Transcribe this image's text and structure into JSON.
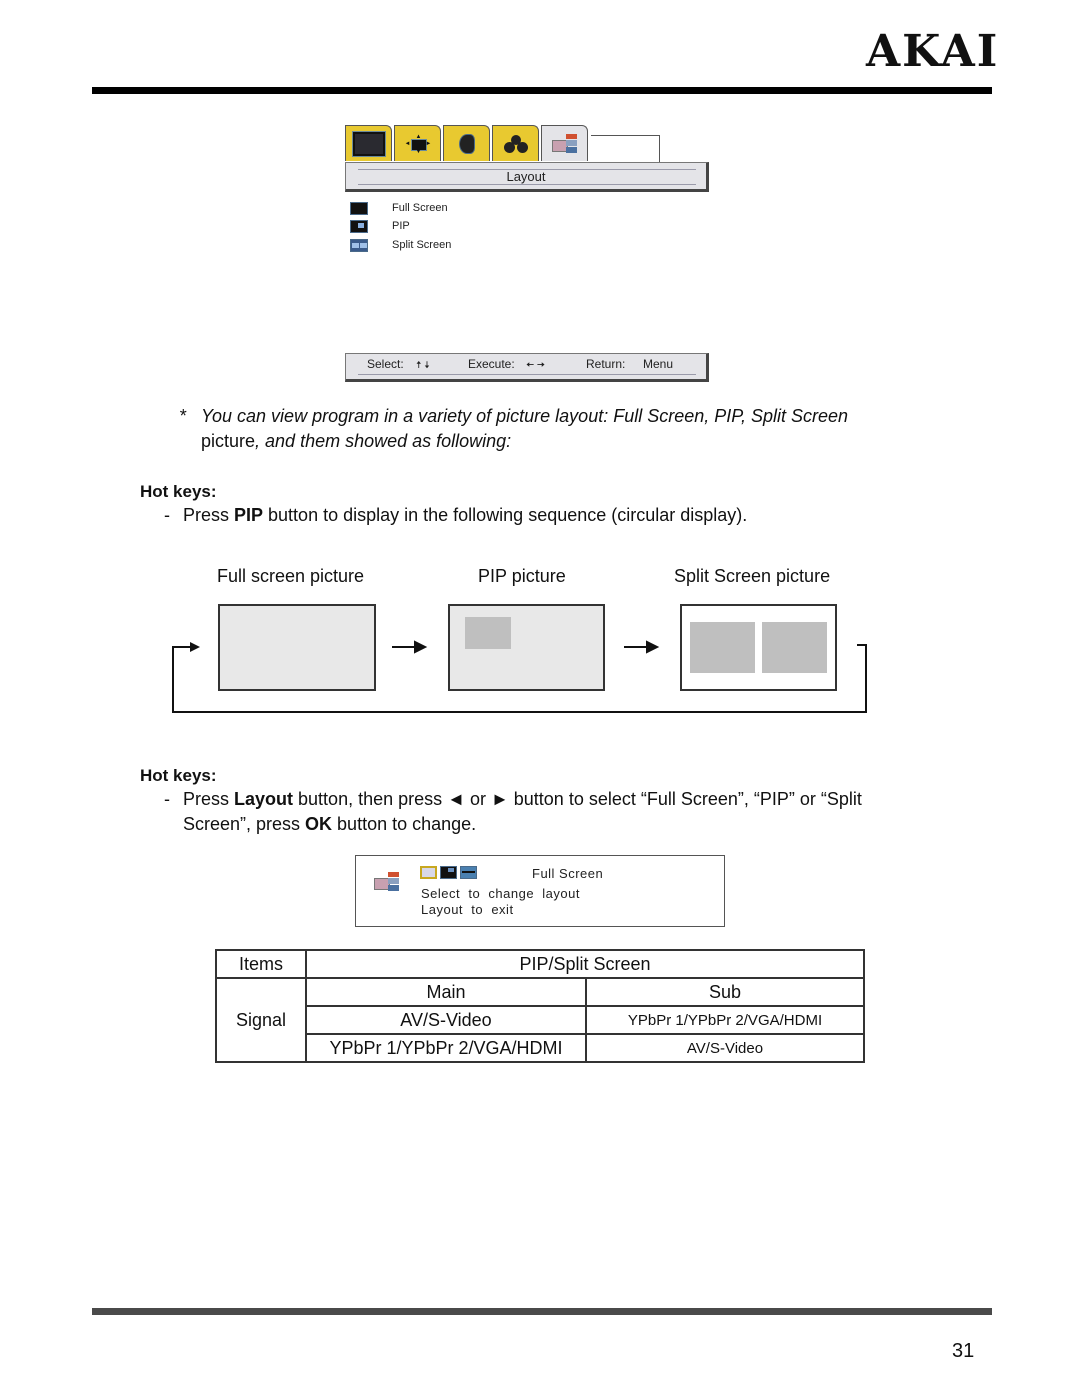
{
  "header": {
    "brand": "AKAI"
  },
  "osd_menu": {
    "tabs": [
      {
        "icon": "picture-icon",
        "active": false
      },
      {
        "icon": "screen-position-icon",
        "active": false
      },
      {
        "icon": "sound-speaker-icon",
        "active": false
      },
      {
        "icon": "feature-icon",
        "active": false
      },
      {
        "icon": "layout-icon",
        "active": true
      }
    ],
    "title": "Layout",
    "options": [
      {
        "label": "Full Screen",
        "icon": "full-screen-icon"
      },
      {
        "label": "PIP",
        "icon": "pip-icon"
      },
      {
        "label": "Split Screen",
        "icon": "split-screen-icon"
      }
    ],
    "nav": {
      "select_label": "Select:",
      "select_keys": "🠅 🠇",
      "execute_label": "Execute:",
      "execute_keys": "🠄 🠆",
      "return_label": "Return:",
      "return_key": "Menu"
    },
    "colors": {
      "tab_yellow": "#e8c930",
      "panel_gray": "#e4e4e8"
    }
  },
  "note": {
    "bullet": "*",
    "line1": "You can view program in a variety of picture layout: Full Screen, PIP, Split Screen",
    "line2_plain": "picture",
    "line2_italic": ", and them showed as following:"
  },
  "hotkeys1": {
    "heading": "Hot keys:",
    "dash": "-",
    "pre": "Press ",
    "key": "PIP",
    "post": " button to display in the following sequence (circular display)."
  },
  "sequence": {
    "captions": [
      "Full screen picture",
      "PIP picture",
      "Split Screen picture"
    ]
  },
  "hotkeys2": {
    "heading": "Hot keys:",
    "dash": "-",
    "pre": "Press ",
    "key1": "Layout",
    "mid": " button, then press ◄ or ► button to select “Full Screen”, “PIP” or “Split",
    "line2_pre": "Screen”, press ",
    "key2": "OK",
    "line2_post": " button to change."
  },
  "popup": {
    "current": "Full Screen",
    "line1": "Select  to  change  layout",
    "line2": "Layout  to  exit"
  },
  "table": {
    "col_items": "Items",
    "col_group": "PIP/Split Screen",
    "row_label": "Signal",
    "sub_headers": [
      "Main",
      "Sub"
    ],
    "rows": [
      [
        "AV/S-Video",
        "YPbPr 1/YPbPr 2/VGA/HDMI"
      ],
      [
        "YPbPr 1/YPbPr 2/VGA/HDMI",
        "AV/S-Video"
      ]
    ]
  },
  "footer": {
    "page_number": "31"
  }
}
